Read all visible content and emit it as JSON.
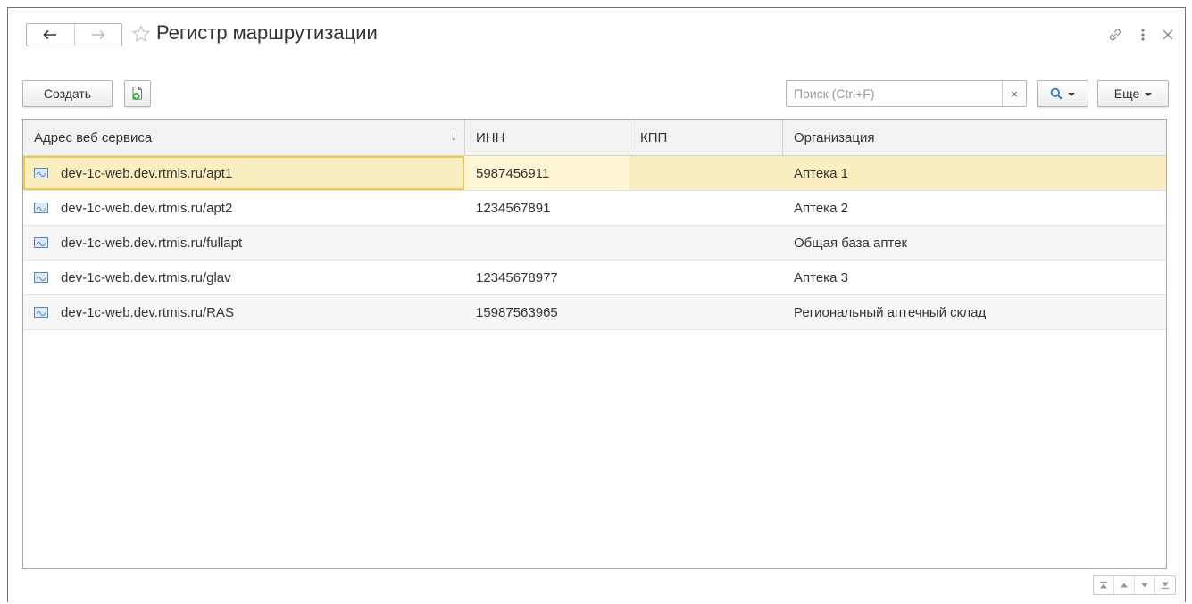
{
  "window": {
    "title": "Регистр маршрутизации"
  },
  "toolbar": {
    "create_label": "Создать",
    "search_placeholder": "Поиск (Ctrl+F)",
    "search_value": "",
    "clear_label": "×",
    "more_label": "Еще"
  },
  "table": {
    "columns": [
      "Адрес веб сервиса",
      "ИНН",
      "КПП",
      "Организация"
    ],
    "sort_indicator": "↓",
    "rows": [
      {
        "address": "dev-1c-web.dev.rtmis.ru/apt1",
        "inn": "5987456911",
        "kpp": "",
        "org": "Аптека 1",
        "selected": true
      },
      {
        "address": "dev-1c-web.dev.rtmis.ru/apt2",
        "inn": "1234567891",
        "kpp": "",
        "org": "Аптека 2"
      },
      {
        "address": "dev-1c-web.dev.rtmis.ru/fullapt",
        "inn": "",
        "kpp": "",
        "org": "Общая база аптек"
      },
      {
        "address": "dev-1c-web.dev.rtmis.ru/glav",
        "inn": "12345678977",
        "kpp": "",
        "org": "Аптека 3"
      },
      {
        "address": "dev-1c-web.dev.rtmis.ru/RAS",
        "inn": "15987563965",
        "kpp": "",
        "org": "Региональный аптечный склад"
      }
    ]
  },
  "colors": {
    "selected_row": "#fbeec0",
    "selected_outline": "#f2c94c",
    "search_icon": "#2a7bd1",
    "add_icon": "#3aa53a"
  },
  "icons": {
    "back": "arrow-left-icon",
    "forward": "arrow-right-icon",
    "favorite": "star-icon",
    "link": "link-icon",
    "menu": "more-vertical-icon",
    "close": "close-icon",
    "copy": "add-copy-icon",
    "search": "search-icon",
    "row": "record-icon",
    "nav": [
      "scroll-top-icon",
      "scroll-up-icon",
      "scroll-down-icon",
      "scroll-bottom-icon"
    ]
  }
}
